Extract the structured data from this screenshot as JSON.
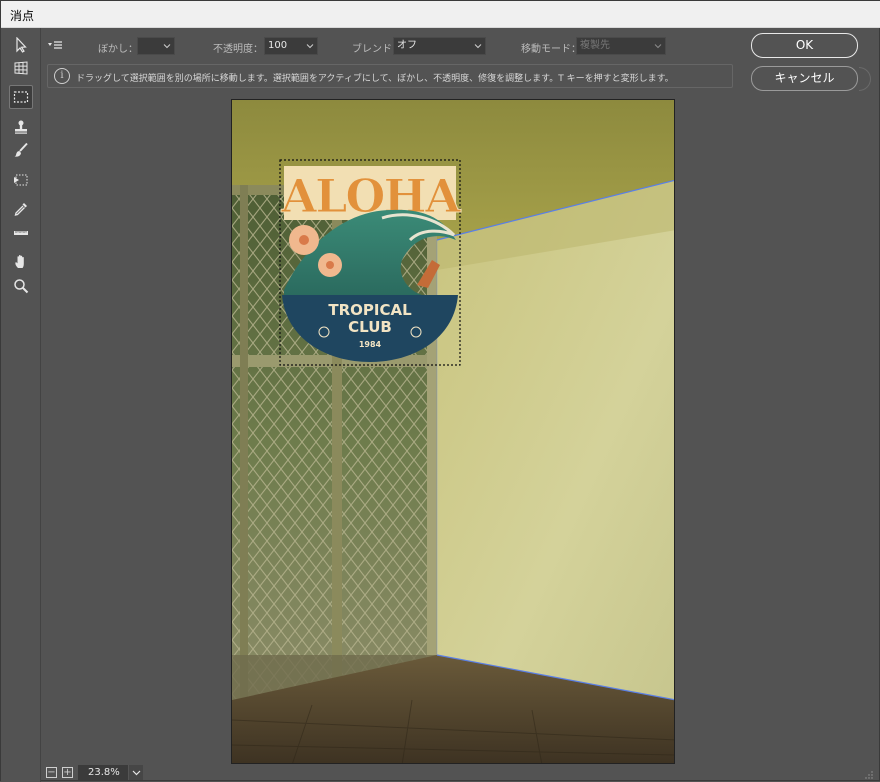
{
  "window": {
    "title": "消点"
  },
  "toolbar": {
    "tools": [
      {
        "name": "edit-plane-tool",
        "icon": "arrow-cursor-icon"
      },
      {
        "name": "create-plane-tool",
        "icon": "grid-plane-icon"
      },
      {
        "name": "marquee-tool",
        "icon": "dashed-rect-icon",
        "active": true
      },
      {
        "name": "stamp-tool",
        "icon": "stamp-icon"
      },
      {
        "name": "brush-tool",
        "icon": "brush-icon"
      },
      {
        "name": "transform-tool",
        "icon": "transform-icon"
      },
      {
        "name": "eyedropper-tool",
        "icon": "eyedropper-icon"
      },
      {
        "name": "measure-tool",
        "icon": "ruler-icon"
      },
      {
        "name": "hand-tool",
        "icon": "hand-icon"
      },
      {
        "name": "zoom-tool",
        "icon": "magnifier-icon"
      }
    ]
  },
  "options": {
    "feather_label": "ぼかし：",
    "feather_value": "",
    "opacity_label": "不透明度：",
    "opacity_value": "100",
    "blend_label": "ブレンド：",
    "blend_value": "オフ",
    "move_mode_label": "移動モード：",
    "move_mode_value": "複製先"
  },
  "info": {
    "message": "ドラッグして選択範囲を別の場所に移動します。選択範囲をアクティブにして、ぼかし、不透明度、修復を調整します。T キーを押すと変形します。"
  },
  "buttons": {
    "ok": "OK",
    "cancel": "キャンセル"
  },
  "artwork": {
    "headline": "ALOHA",
    "line1": "TROPICAL",
    "line2": "CLUB",
    "year": "1984"
  },
  "status": {
    "zoom": "23.8%",
    "zoom_out": "−",
    "zoom_in": "+"
  }
}
